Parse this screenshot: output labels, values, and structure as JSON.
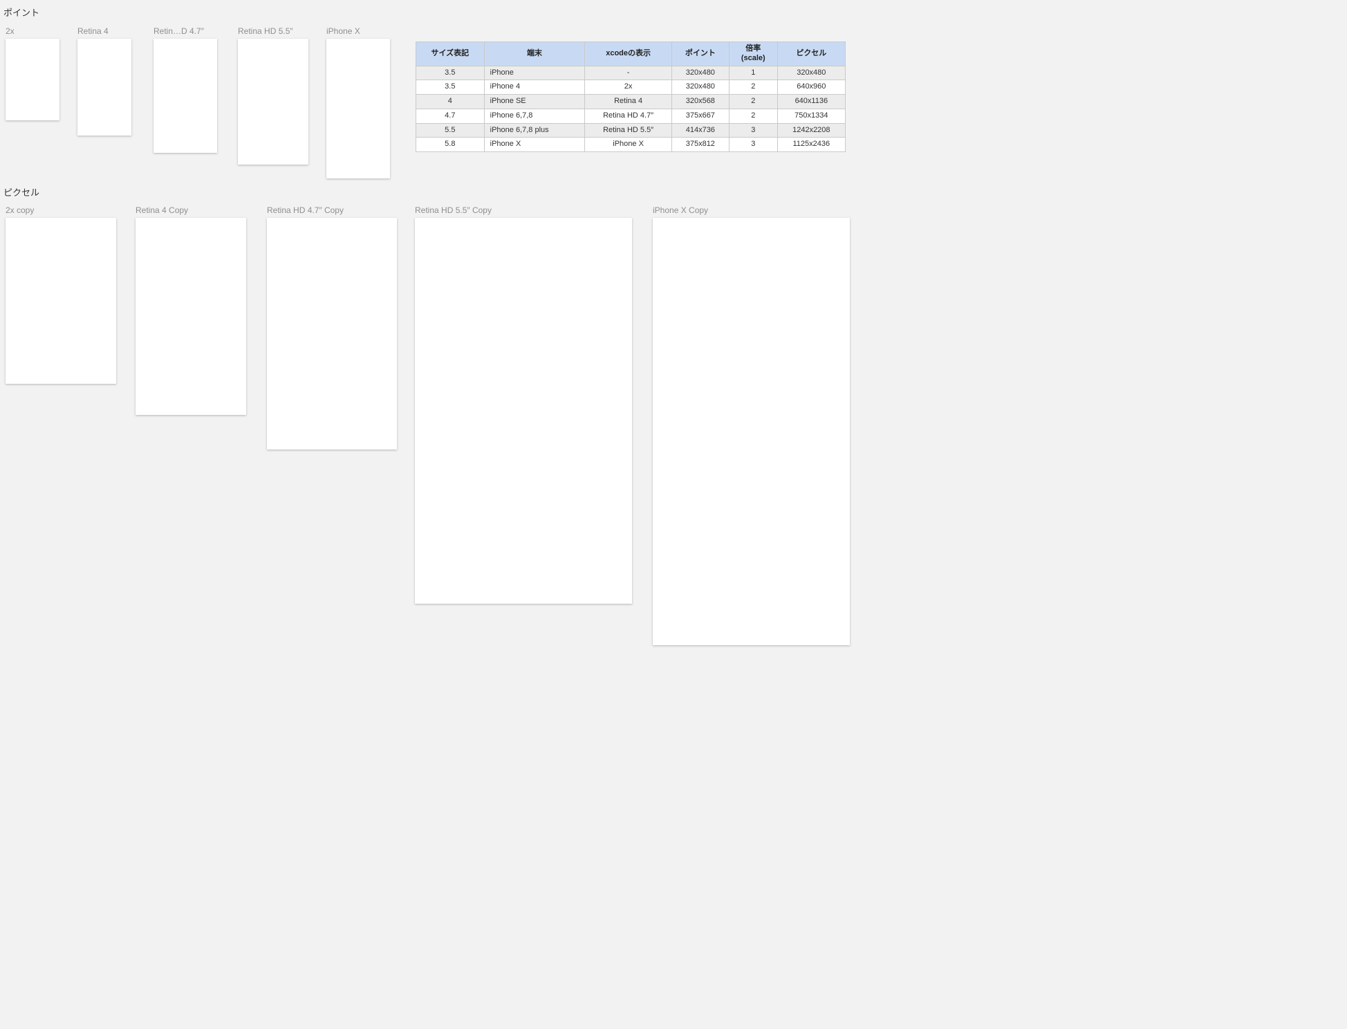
{
  "sections": {
    "points_title": "ポイント",
    "pixels_title": "ピクセル"
  },
  "points_artboards": [
    {
      "label": "2x"
    },
    {
      "label": "Retina 4"
    },
    {
      "label": "Retin…D 4.7″"
    },
    {
      "label": "Retina HD 5.5″"
    },
    {
      "label": "iPhone X"
    }
  ],
  "pixels_artboards": [
    {
      "label": "2x copy"
    },
    {
      "label": "Retina 4 Copy"
    },
    {
      "label": "Retina HD 4.7″ Copy"
    },
    {
      "label": "Retina HD 5.5″ Copy"
    },
    {
      "label": "iPhone X Copy"
    }
  ],
  "table": {
    "headers": [
      "サイズ表記",
      "端末",
      "xcodeの表示",
      "ポイント",
      "倍率\n(scale)",
      "ピクセル"
    ],
    "rows": [
      [
        "3.5",
        "iPhone",
        "-",
        "320x480",
        "1",
        "320x480"
      ],
      [
        "3.5",
        "iPhone 4",
        "2x",
        "320x480",
        "2",
        "640x960"
      ],
      [
        "4",
        "iPhone SE",
        "Retina 4",
        "320x568",
        "2",
        "640x1136"
      ],
      [
        "4.7",
        "iPhone 6,7,8",
        "Retina HD 4.7″",
        "375x667",
        "2",
        "750x1334"
      ],
      [
        "5.5",
        "iPhone 6,7,8 plus",
        "Retina HD 5.5″",
        "414x736",
        "3",
        "1242x2208"
      ],
      [
        "5.8",
        "iPhone X",
        "iPhone X",
        "375x812",
        "3",
        "1125x2436"
      ]
    ]
  }
}
